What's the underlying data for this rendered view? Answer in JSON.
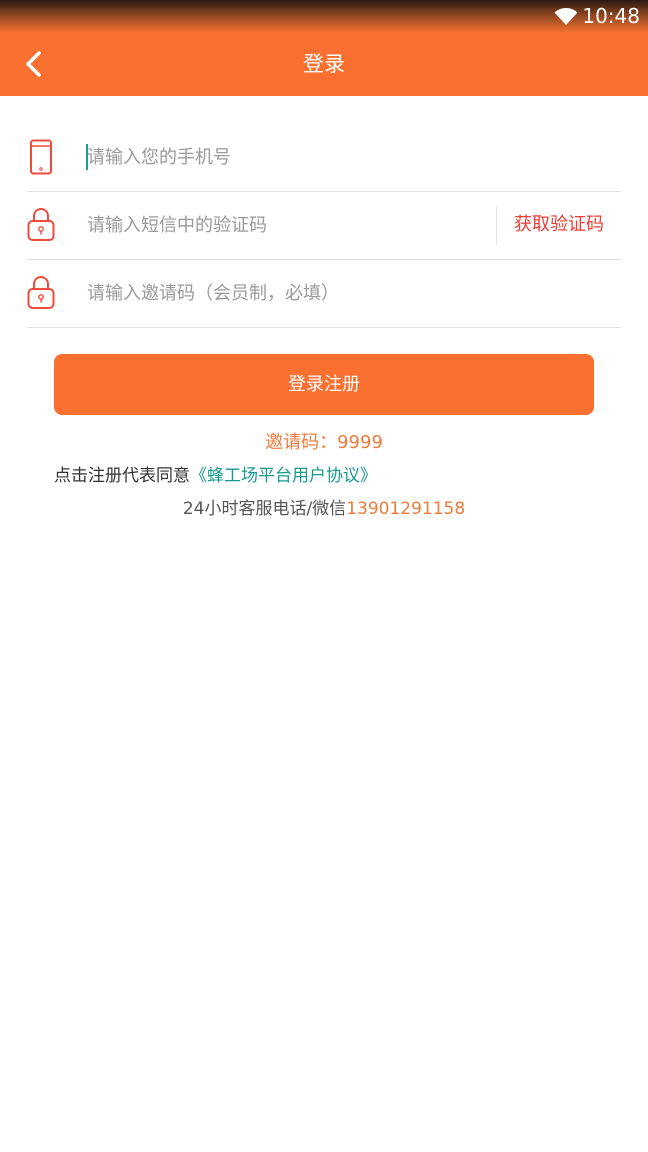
{
  "status_bar": {
    "time": "10:48",
    "wifi_icon": "wifi-icon"
  },
  "header": {
    "title": "登录",
    "back_icon": "chevron-left-icon"
  },
  "form": {
    "phone": {
      "placeholder": "请输入您的手机号",
      "value": "",
      "icon": "phone-icon"
    },
    "sms_code": {
      "placeholder": "请输入短信中的验证码",
      "value": "",
      "icon": "lock-icon",
      "get_code_label": "获取验证码"
    },
    "invite": {
      "placeholder": "请输入邀请码（会员制，必填）",
      "value": "",
      "icon": "lock-icon"
    }
  },
  "login_button": {
    "label": "登录注册"
  },
  "invite_hint": "邀请码：9999",
  "agreement": {
    "prefix": "点击注册代表同意",
    "link": "《蜂工场平台用户协议》"
  },
  "hotline": {
    "prefix": "24小时客服电话/微信",
    "number": "13901291158"
  },
  "colors": {
    "brand": "#fb7031",
    "link": "#169a8f",
    "get_code": "#ee3d34",
    "hint": "#f07a3a"
  }
}
